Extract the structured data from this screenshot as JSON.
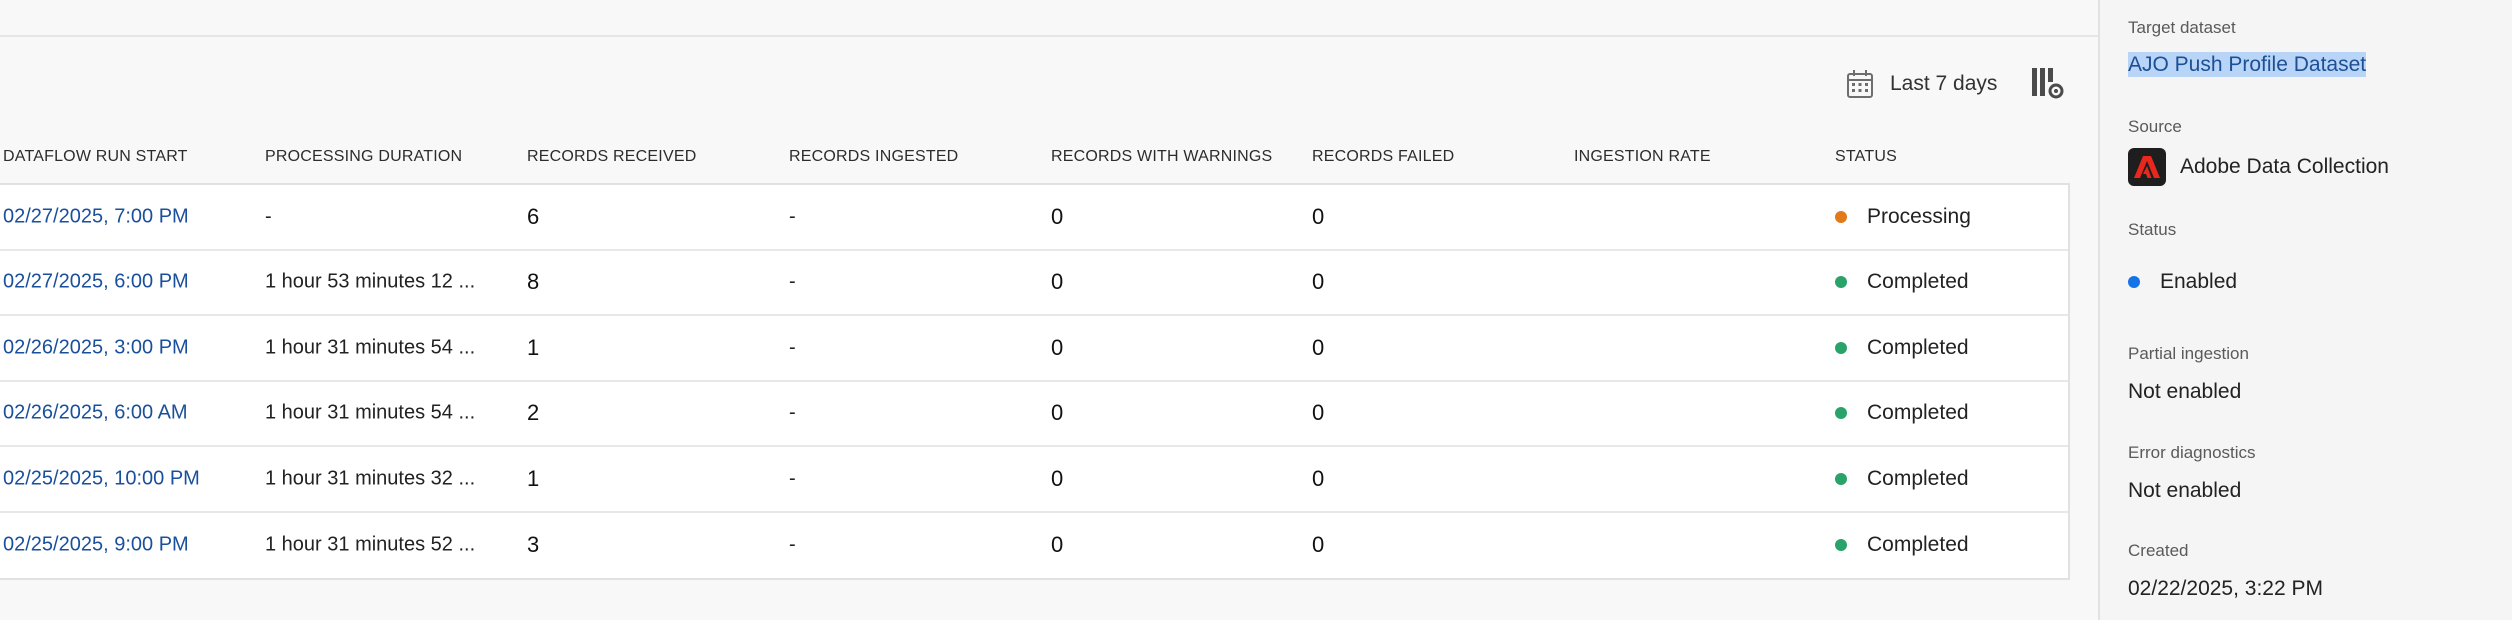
{
  "toolbar": {
    "date_filter_label": "Last 7 days",
    "calendar_icon": "calendar-icon",
    "settings_icon": "column-settings-icon"
  },
  "table": {
    "headers": [
      "DATAFLOW RUN START",
      "PROCESSING DURATION",
      "RECORDS RECEIVED",
      "RECORDS INGESTED",
      "RECORDS WITH WARNINGS",
      "RECORDS FAILED",
      "INGESTION RATE",
      "STATUS"
    ],
    "rows": [
      {
        "run_start": "02/27/2025, 7:00 PM",
        "duration": "-",
        "received": "6",
        "ingested": "-",
        "warnings": "0",
        "failed": "0",
        "rate": "",
        "status": "Processing",
        "status_color": "#e07a1a"
      },
      {
        "run_start": "02/27/2025, 6:00 PM",
        "duration": "1 hour 53 minutes 12 ...",
        "received": "8",
        "ingested": "-",
        "warnings": "0",
        "failed": "0",
        "rate": "",
        "status": "Completed",
        "status_color": "#2aa36b"
      },
      {
        "run_start": "02/26/2025, 3:00 PM",
        "duration": "1 hour 31 minutes 54 ...",
        "received": "1",
        "ingested": "-",
        "warnings": "0",
        "failed": "0",
        "rate": "",
        "status": "Completed",
        "status_color": "#2aa36b"
      },
      {
        "run_start": "02/26/2025, 6:00 AM",
        "duration": "1 hour 31 minutes 54 ...",
        "received": "2",
        "ingested": "-",
        "warnings": "0",
        "failed": "0",
        "rate": "",
        "status": "Completed",
        "status_color": "#2aa36b"
      },
      {
        "run_start": "02/25/2025, 10:00 PM",
        "duration": "1 hour 31 minutes 32 ...",
        "received": "1",
        "ingested": "-",
        "warnings": "0",
        "failed": "0",
        "rate": "",
        "status": "Completed",
        "status_color": "#2aa36b"
      },
      {
        "run_start": "02/25/2025, 9:00 PM",
        "duration": "1 hour 31 minutes 52 ...",
        "received": "3",
        "ingested": "-",
        "warnings": "0",
        "failed": "0",
        "rate": "",
        "status": "Completed",
        "status_color": "#2aa36b"
      }
    ]
  },
  "rail": {
    "target_dataset_label": "Target dataset",
    "target_dataset_value": "AJO Push Profile Dataset",
    "source_label": "Source",
    "source_value": "Adobe Data Collection",
    "source_icon": "adobe-logo-icon",
    "status_label": "Status",
    "status_value": "Enabled",
    "status_color": "#1473e6",
    "partial_label": "Partial ingestion",
    "partial_value": "Not enabled",
    "error_label": "Error diagnostics",
    "error_value": "Not enabled",
    "created_label": "Created",
    "created_value": "02/22/2025, 3:22 PM"
  }
}
